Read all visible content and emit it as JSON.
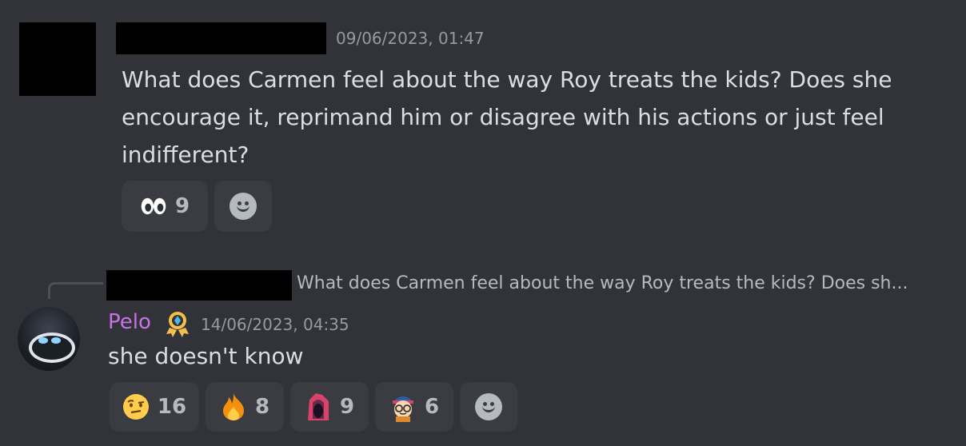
{
  "message1": {
    "timestamp": "09/06/2023, 01:47",
    "text": "What does Carmen feel about the way Roy treats the kids? Does she encourage it, reprimand him or disagree with his actions or just feel indifferent?",
    "reactions": [
      {
        "emoji": "eyes-emoji",
        "count": "9"
      }
    ]
  },
  "message2": {
    "reply_preview": "What does Carmen feel about the way Roy treats the kids? Does sh...",
    "username": "Pelo",
    "username_color": "#c673e6",
    "timestamp": "14/06/2023, 04:35",
    "text": "she doesn't know",
    "reactions": [
      {
        "emoji": "raised-eyebrow-emoji",
        "count": "16"
      },
      {
        "emoji": "fire-emoji",
        "count": "8"
      },
      {
        "emoji": "custom-scream-emoji",
        "count": "9"
      },
      {
        "emoji": "custom-nerd-emoji",
        "count": "6"
      }
    ]
  }
}
